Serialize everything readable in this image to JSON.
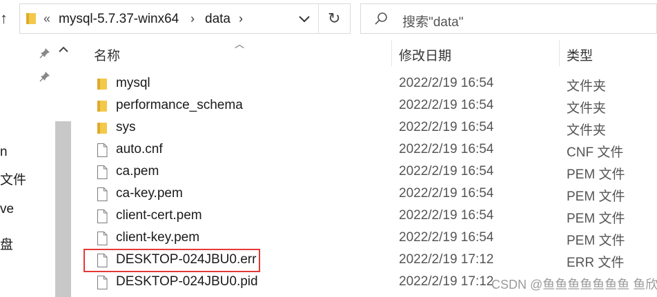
{
  "address_bar": {
    "overflow": "«",
    "crumbs": [
      "mysql-5.7.37-winx64",
      "data"
    ]
  },
  "search": {
    "placeholder": "搜索\"data\""
  },
  "left_pane": {
    "fragments": [
      "n",
      "文件",
      "ve",
      "盘"
    ]
  },
  "columns": {
    "name": "名称",
    "date": "修改日期",
    "type": "类型"
  },
  "files": [
    {
      "name": "mysql",
      "date": "2022/2/19 16:54",
      "type": "文件夹",
      "kind": "folder"
    },
    {
      "name": "performance_schema",
      "date": "2022/2/19 16:54",
      "type": "文件夹",
      "kind": "folder"
    },
    {
      "name": "sys",
      "date": "2022/2/19 16:54",
      "type": "文件夹",
      "kind": "folder"
    },
    {
      "name": "auto.cnf",
      "date": "2022/2/19 16:54",
      "type": "CNF 文件",
      "kind": "file"
    },
    {
      "name": "ca.pem",
      "date": "2022/2/19 16:54",
      "type": "PEM 文件",
      "kind": "file"
    },
    {
      "name": "ca-key.pem",
      "date": "2022/2/19 16:54",
      "type": "PEM 文件",
      "kind": "file"
    },
    {
      "name": "client-cert.pem",
      "date": "2022/2/19 16:54",
      "type": "PEM 文件",
      "kind": "file"
    },
    {
      "name": "client-key.pem",
      "date": "2022/2/19 16:54",
      "type": "PEM 文件",
      "kind": "file"
    },
    {
      "name": "DESKTOP-024JBU0.err",
      "date": "2022/2/19 17:12",
      "type": "ERR 文件",
      "kind": "file"
    },
    {
      "name": "DESKTOP-024JBU0.pid",
      "date": "2022/2/19 17:12",
      "type": "",
      "kind": "file"
    }
  ],
  "watermark": "CSDN @鱼鱼鱼鱼鱼鱼鱼 鱼欣",
  "colors": {
    "folder": "#f2c94c",
    "highlight": "#e53935",
    "scrollbar": "#c8c8c8"
  }
}
